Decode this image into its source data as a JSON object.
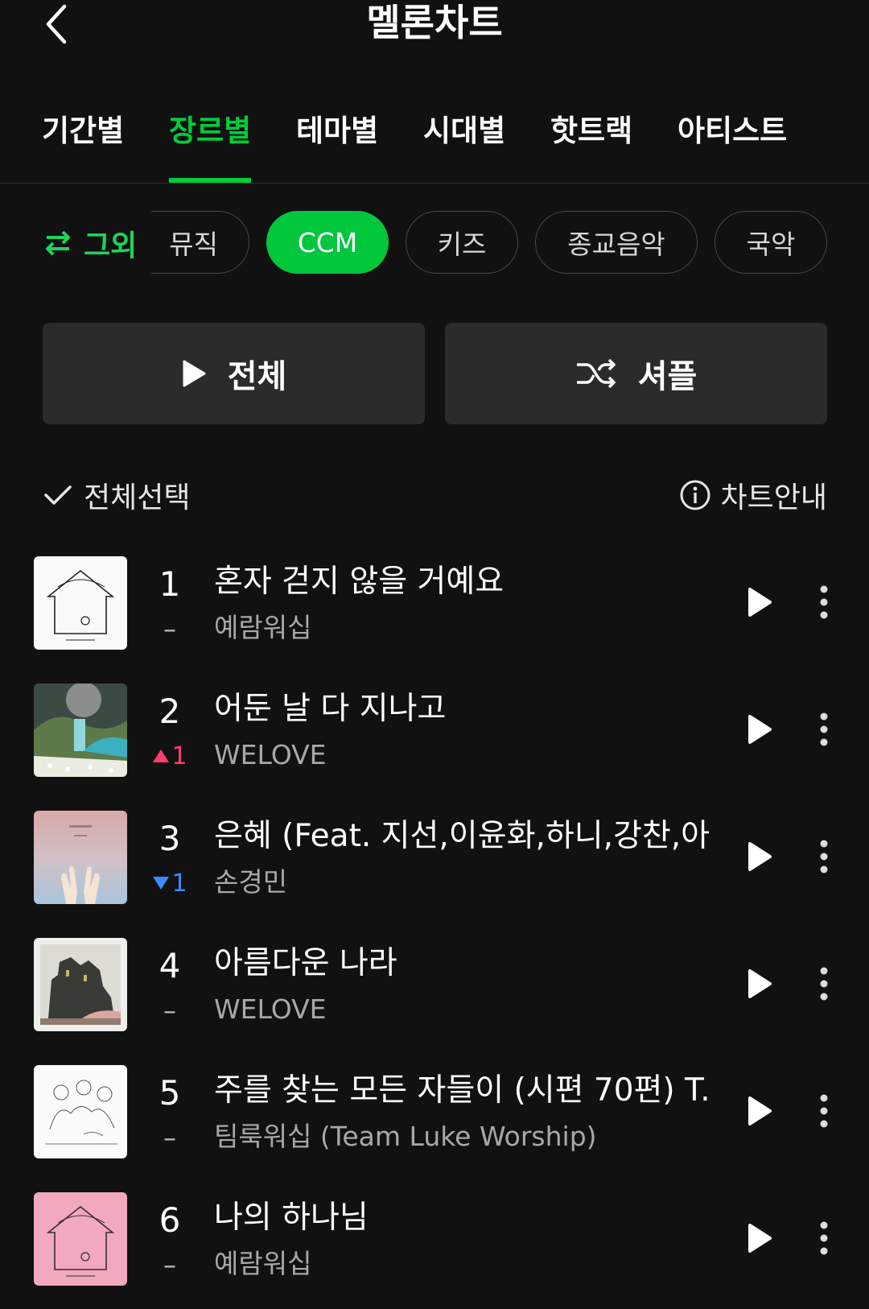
{
  "header": {
    "title": "멜론차트",
    "back_icon": "chevron-left-icon"
  },
  "tabs": [
    {
      "label": "기간별",
      "active": false
    },
    {
      "label": "장르별",
      "active": true
    },
    {
      "label": "테마별",
      "active": false
    },
    {
      "label": "시대별",
      "active": false
    },
    {
      "label": "핫트랙",
      "active": false
    },
    {
      "label": "아티스트",
      "active": false
    }
  ],
  "genre_filter": {
    "toggle_label": "그외",
    "toggle_icon": "swap-arrows-icon",
    "chips": [
      {
        "label": "뮤직",
        "active": false,
        "partial": true
      },
      {
        "label": "CCM",
        "active": true
      },
      {
        "label": "키즈",
        "active": false
      },
      {
        "label": "종교음악",
        "active": false
      },
      {
        "label": "국악",
        "active": false
      }
    ]
  },
  "actions": {
    "play_all_label": "전체",
    "shuffle_label": "셔플"
  },
  "select_row": {
    "select_all_label": "전체선택",
    "chart_guide_label": "차트안내"
  },
  "colors": {
    "accent": "#00cd3c",
    "background": "#111111",
    "rank_up": "#ff3d6e",
    "rank_down": "#3d8bff"
  },
  "songs": [
    {
      "rank": "1",
      "change": "–",
      "change_type": "same",
      "title": "혼자 걷지 않을 거예요",
      "artist": "예람워십",
      "art": "white-house"
    },
    {
      "rank": "2",
      "change": "1",
      "change_type": "up",
      "title": "어둔 날 다 지나고",
      "artist": "WELOVE",
      "art": "moon-landscape"
    },
    {
      "rank": "3",
      "change": "1",
      "change_type": "down",
      "title": "은혜 (Feat. 지선,이윤화,하니,강찬,아...",
      "artist": "손경민",
      "art": "pink-hands"
    },
    {
      "rank": "4",
      "change": "–",
      "change_type": "same",
      "title": "아름다운 나라",
      "artist": "WELOVE",
      "art": "castle"
    },
    {
      "rank": "5",
      "change": "–",
      "change_type": "same",
      "title": "주를 찾는 모든 자들이 (시편 70편) T...",
      "artist": "팀룩워십 (Team Luke Worship)",
      "art": "sketch"
    },
    {
      "rank": "6",
      "change": "–",
      "change_type": "same",
      "title": "나의 하나님",
      "artist": "예람워십",
      "art": "pink-house"
    }
  ]
}
